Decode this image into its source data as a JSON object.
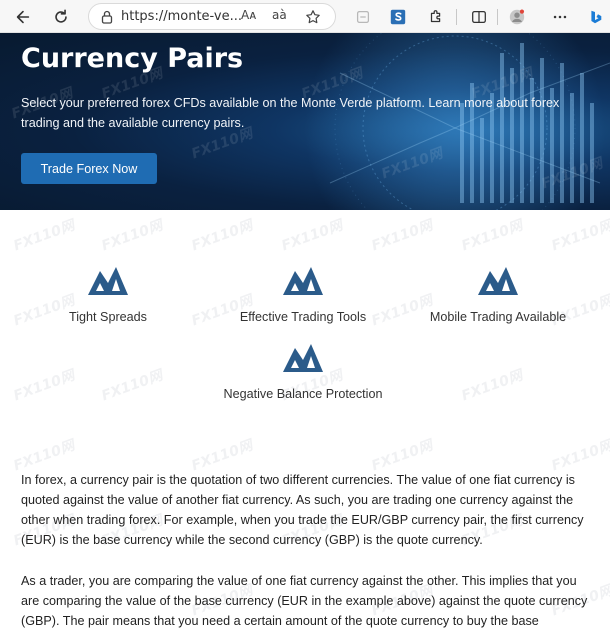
{
  "browser": {
    "url": "https://monte-ve...",
    "read_aloud_label": "Aᴀ",
    "translate_label": "aà"
  },
  "hero": {
    "title": "Currency Pairs",
    "description": "Select your preferred forex CFDs available on the Monte Verde platform. Learn more about forex trading and the available currency pairs.",
    "button_label": "Trade Forex Now"
  },
  "features": [
    {
      "label": "Tight Spreads"
    },
    {
      "label": "Effective Trading Tools"
    },
    {
      "label": "Mobile Trading Available"
    },
    {
      "label": "Negative Balance Protection"
    }
  ],
  "content": {
    "paragraph1": "In forex, a currency pair is the quotation of two different currencies. The value of one fiat currency is quoted against the value of another fiat currency. As such, you are trading one currency against the other when trading forex. For example, when you trade the EUR/GBP currency pair, the first currency (EUR) is the base currency while the second currency (GBP) is the quote currency.",
    "paragraph2": "As a trader, you are comparing the value of one fiat currency against the other. This implies that you are comparing the value of the base currency (EUR in the example above) against the quote currency (GBP). The pair means that you need a certain amount of the quote currency to buy the base currency."
  },
  "watermark_text": "FX110网",
  "colors": {
    "hero_bg": "#0a2140",
    "button_bg": "#1f6cb3",
    "logo": "#2b5b8a"
  }
}
